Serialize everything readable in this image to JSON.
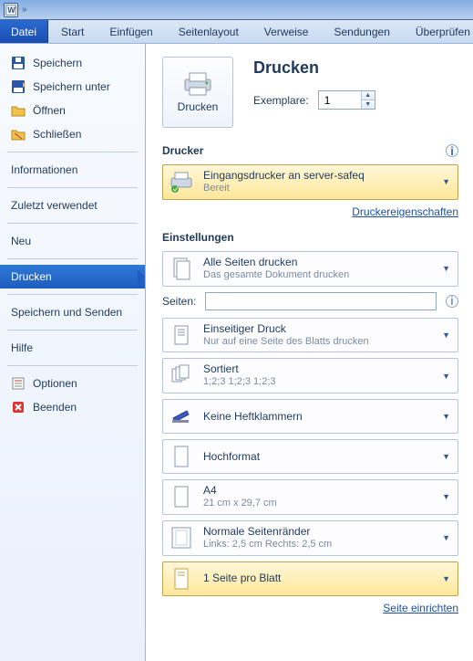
{
  "titlebar": {
    "breadcrumb": "»"
  },
  "tabs": {
    "file": "Datei",
    "start": "Start",
    "insert": "Einfügen",
    "layout": "Seitenlayout",
    "references": "Verweise",
    "mailings": "Sendungen",
    "review": "Überprüfen"
  },
  "sidebar": {
    "save": "Speichern",
    "save_as": "Speichern unter",
    "open": "Öffnen",
    "close": "Schließen",
    "info": "Informationen",
    "recent": "Zuletzt verwendet",
    "new": "Neu",
    "print": "Drucken",
    "save_send": "Speichern und Senden",
    "help": "Hilfe",
    "options": "Optionen",
    "exit": "Beenden"
  },
  "print": {
    "button": "Drucken",
    "heading": "Drucken",
    "copies_label": "Exemplare:",
    "copies_value": "1"
  },
  "printer": {
    "heading": "Drucker",
    "name": "Eingangsdrucker an server-safeq",
    "status": "Bereit",
    "props_link": "Druckereigenschaften"
  },
  "settings": {
    "heading": "Einstellungen",
    "pages_label": "Seiten:",
    "pages_value": "",
    "scope": {
      "main": "Alle Seiten drucken",
      "sub": "Das gesamte Dokument drucken"
    },
    "sides": {
      "main": "Einseitiger Druck",
      "sub": "Nur auf eine Seite des Blatts drucken"
    },
    "collate": {
      "main": "Sortiert",
      "sub": "1;2;3   1;2;3   1;2;3"
    },
    "staple": {
      "main": "Keine Heftklammern",
      "sub": ""
    },
    "orient": {
      "main": "Hochformat",
      "sub": ""
    },
    "size": {
      "main": "A4",
      "sub": "21  cm x 29,7  cm"
    },
    "margins": {
      "main": "Normale Seitenränder",
      "sub": "Links: 2,5  cm   Rechts: 2,5  cm"
    },
    "per_sheet": {
      "main": "1 Seite pro Blatt",
      "sub": ""
    },
    "page_setup": "Seite einrichten"
  }
}
